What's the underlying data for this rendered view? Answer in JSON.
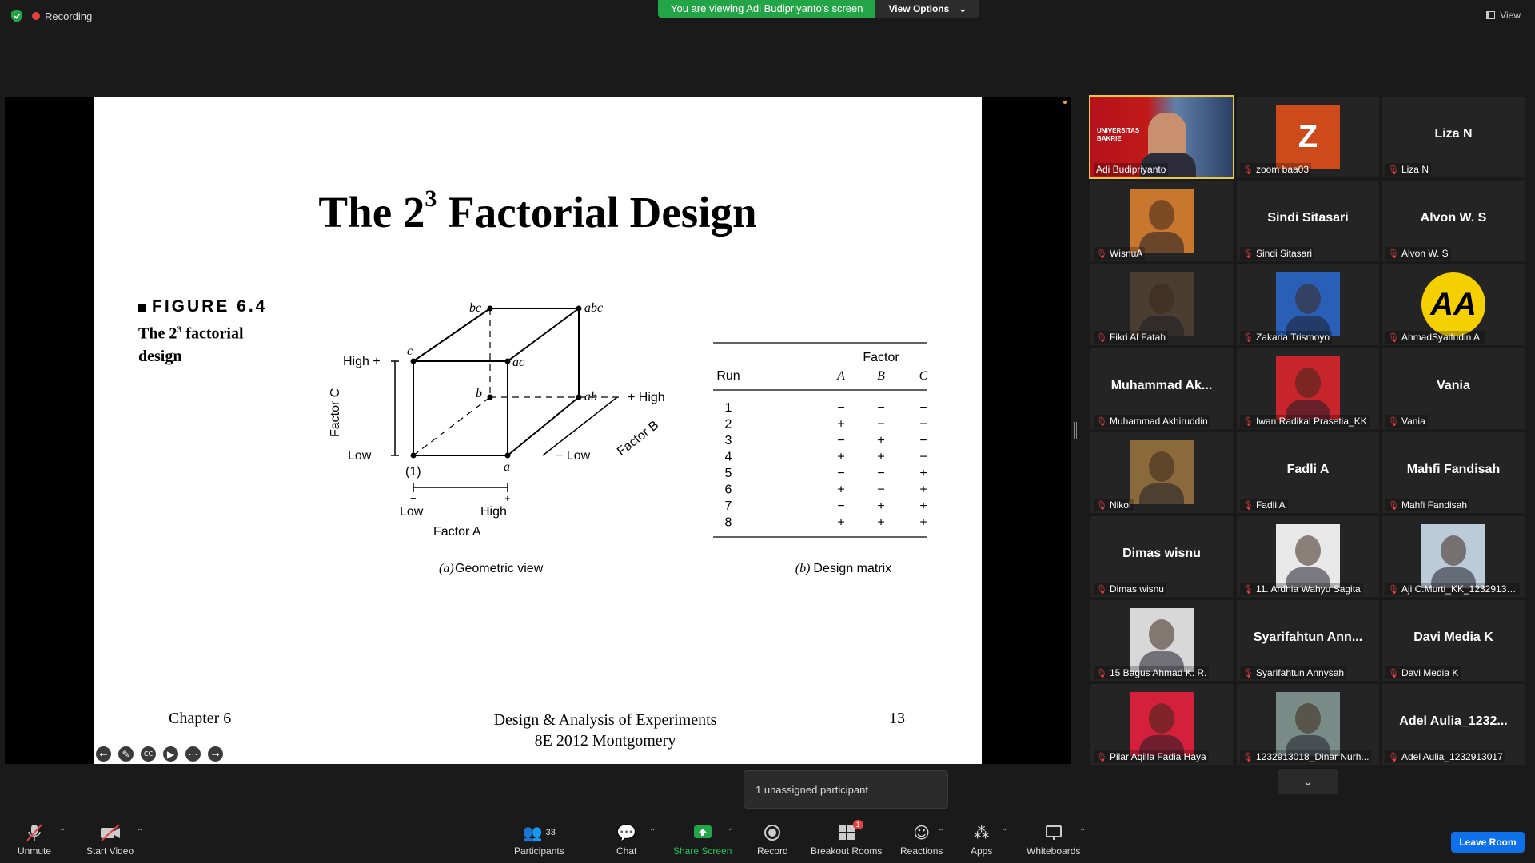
{
  "top": {
    "recording": "Recording",
    "viewing_banner": "You are viewing Adi Budipriyanto's screen",
    "view_options": "View Options",
    "view": "View"
  },
  "slide": {
    "title_main": "The 2",
    "title_exp": "3",
    "title_rest": " Factorial Design",
    "figure_label": "FIGURE 6.4",
    "figure_sub_1": "The 2",
    "figure_sub_exp": "3",
    "figure_sub_2": " factorial design",
    "cube": {
      "vertices": [
        "(1)",
        "a",
        "b",
        "ab",
        "c",
        "ac",
        "bc",
        "abc"
      ],
      "factor_c": "Factor C",
      "factor_b": "Factor B",
      "factor_a": "Factor A",
      "high_c": "High +",
      "low_c": "Low",
      "high_b": "+ High",
      "low_b": "− Low",
      "low_a": "Low",
      "high_a": "High",
      "minus": "−",
      "plus": "+",
      "caption_letter": "(a)",
      "caption": "Geometric view"
    },
    "matrix": {
      "factor_header": "Factor",
      "columns": [
        "Run",
        "A",
        "B",
        "C"
      ],
      "rows": [
        [
          "1",
          "−",
          "−",
          "−"
        ],
        [
          "2",
          "+",
          "−",
          "−"
        ],
        [
          "3",
          "−",
          "+",
          "−"
        ],
        [
          "4",
          "+",
          "+",
          "−"
        ],
        [
          "5",
          "−",
          "−",
          "+"
        ],
        [
          "6",
          "+",
          "−",
          "+"
        ],
        [
          "7",
          "−",
          "+",
          "+"
        ],
        [
          "8",
          "+",
          "+",
          "+"
        ]
      ],
      "caption_letter": "(b)",
      "caption": "Design matrix"
    },
    "footer_left": "Chapter 6",
    "footer_center_1": "Design & Analysis of Experiments",
    "footer_center_2": "8E 2012 Montgomery",
    "page_number": "13",
    "controls": [
      "back-icon",
      "pen-icon",
      "cc-icon",
      "video-icon",
      "more-icon",
      "forward-icon"
    ]
  },
  "gallery": [
    {
      "name": "Adi Budipriyanto",
      "display": "",
      "kind": "video",
      "active": true
    },
    {
      "name": "zoom baa03",
      "display": "",
      "kind": "letter",
      "letter": "Z"
    },
    {
      "name": "Liza N",
      "display": "Liza N",
      "kind": "name"
    },
    {
      "name": "WisnuA",
      "display": "",
      "kind": "photo",
      "color": "#c9772e"
    },
    {
      "name": "Sindi Sitasari",
      "display": "Sindi Sitasari",
      "kind": "name"
    },
    {
      "name": "Alvon W. S",
      "display": "Alvon W. S",
      "kind": "name"
    },
    {
      "name": "Fikri Al Fatah",
      "display": "",
      "kind": "photo",
      "color": "#4a3e30"
    },
    {
      "name": "Zakaria Trismoyo",
      "display": "",
      "kind": "photo",
      "color": "#2a5fb8"
    },
    {
      "name": "AhmadSyaifudin A.",
      "display": "",
      "kind": "aa",
      "letter": "AA"
    },
    {
      "name": "Muhammad Akhiruddin",
      "display": "Muhammad Ak...",
      "kind": "name"
    },
    {
      "name": "Iwan Radikal Prasetia_KK",
      "display": "",
      "kind": "photo",
      "color": "#c8242c"
    },
    {
      "name": "Vania",
      "display": "Vania",
      "kind": "name"
    },
    {
      "name": "Nikol",
      "display": "",
      "kind": "photo",
      "color": "#8a6a3a"
    },
    {
      "name": "Fadli A",
      "display": "Fadli A",
      "kind": "name"
    },
    {
      "name": "Mahfi Fandisah",
      "display": "Mahfi Fandisah",
      "kind": "name"
    },
    {
      "name": "Dimas wisnu",
      "display": "Dimas wisnu",
      "kind": "name"
    },
    {
      "name": "11. Ardhia Wahyu Sagita",
      "display": "",
      "kind": "photo",
      "color": "#e8e8e8"
    },
    {
      "name": "Aji C.Murti_KK_12329130...",
      "display": "",
      "kind": "photo",
      "color": "#bccbd8"
    },
    {
      "name": "15 Bagus Ahmad K. R.",
      "display": "",
      "kind": "photo",
      "color": "#d8d8d8"
    },
    {
      "name": "Syarifahtun Annysah",
      "display": "Syarifahtun Ann...",
      "kind": "name"
    },
    {
      "name": "Davi Media K",
      "display": "Davi Media K",
      "kind": "name"
    },
    {
      "name": "Pilar Aqilla Fadia Haya",
      "display": "",
      "kind": "photo",
      "color": "#d4203a"
    },
    {
      "name": "1232913018_Dinar Nurh...",
      "display": "",
      "kind": "photo",
      "color": "#7a8c88"
    },
    {
      "name": "Adel Aulia_1232913017",
      "display": "Adel Aulia_1232...",
      "kind": "name"
    }
  ],
  "tooltip": "1 unassigned participant",
  "toolbar": {
    "unmute": "Unmute",
    "start_video": "Start Video",
    "participants": "Participants",
    "participants_count": "33",
    "chat": "Chat",
    "share_screen": "Share Screen",
    "record": "Record",
    "breakout_rooms": "Breakout Rooms",
    "breakout_badge": "1",
    "reactions": "Reactions",
    "apps": "Apps",
    "whiteboards": "Whiteboards",
    "leave": "Leave Room"
  },
  "colors": {
    "share_green": "#23a446",
    "leave_blue": "#0e71eb",
    "active_speaker": "#e8c842",
    "muted_red": "#e34040"
  }
}
